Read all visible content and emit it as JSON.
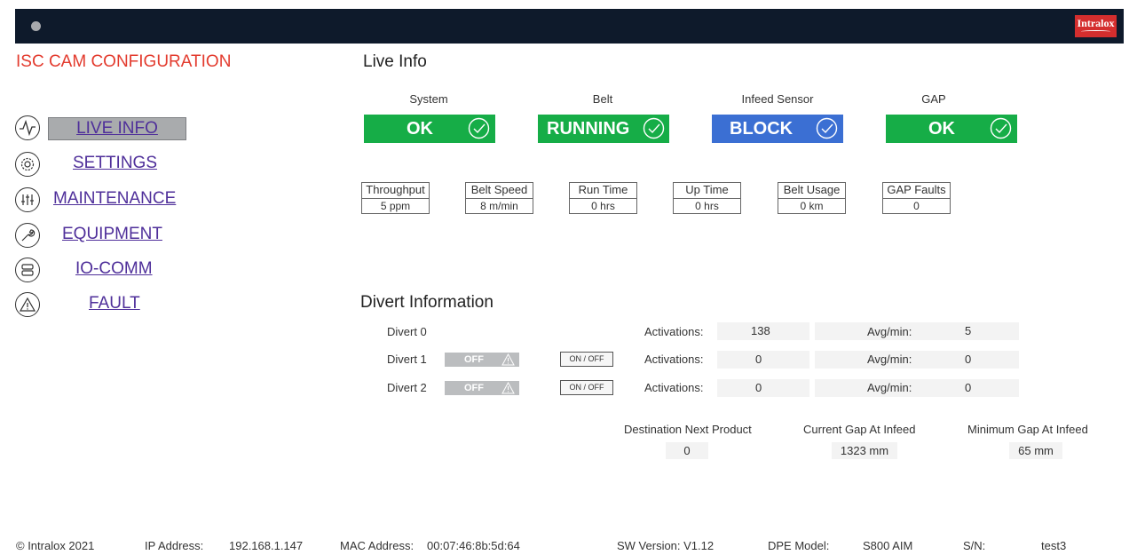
{
  "header": {
    "logo_text": "Intralox"
  },
  "app_title": "ISC CAM CONFIGURATION",
  "nav": [
    {
      "label": "LIVE INFO",
      "icon": "pulse-icon",
      "active": true
    },
    {
      "label": "SETTINGS",
      "icon": "gear-icon"
    },
    {
      "label": "MAINTENANCE",
      "icon": "sliders-icon"
    },
    {
      "label": "EQUIPMENT",
      "icon": "wrench-icon"
    },
    {
      "label": "IO-COMM",
      "icon": "server-icon"
    },
    {
      "label": "FAULT",
      "icon": "warning-icon"
    }
  ],
  "live_info": {
    "title": "Live Info",
    "statuses": [
      {
        "label": "System",
        "value": "OK",
        "color": "#16ad47"
      },
      {
        "label": "Belt",
        "value": "RUNNING",
        "color": "#16ad47"
      },
      {
        "label": "Infeed Sensor",
        "value": "BLOCK",
        "color": "#3b6fd3"
      },
      {
        "label": "GAP",
        "value": "OK",
        "color": "#16ad47"
      }
    ],
    "metrics": [
      {
        "label": "Throughput",
        "value": "5 ppm"
      },
      {
        "label": "Belt Speed",
        "value": "8 m/min"
      },
      {
        "label": "Run Time",
        "value": "0 hrs"
      },
      {
        "label": "Up Time",
        "value": "0 hrs"
      },
      {
        "label": "Belt Usage",
        "value": "0 km"
      },
      {
        "label": "GAP Faults",
        "value": "0"
      }
    ]
  },
  "divert": {
    "title": "Divert Information",
    "activations_label": "Activations:",
    "avg_label": "Avg/min:",
    "toggle_label": "OFF",
    "onoff_label": "ON / OFF",
    "rows": [
      {
        "name": "Divert 0",
        "activations": "138",
        "avg": "5"
      },
      {
        "name": "Divert 1",
        "activations": "0",
        "avg": "0"
      },
      {
        "name": "Divert 2",
        "activations": "0",
        "avg": "0"
      }
    ]
  },
  "gap_info": {
    "destination_label": "Destination Next Product",
    "destination_value": "0",
    "current_gap_label": "Current Gap At Infeed",
    "current_gap_value": "1323 mm",
    "min_gap_label": "Minimum Gap At Infeed",
    "min_gap_value": "65 mm"
  },
  "footer": {
    "copyright": "© Intralox 2021",
    "ip_label": "IP Address:",
    "ip_value": "192.168.1.147",
    "mac_label": "MAC Address:",
    "mac_value": "00:07:46:8b:5d:64",
    "sw_version": "SW Version: V1.12",
    "dpe_label": "DPE Model:",
    "dpe_value": "S800 AIM",
    "sn_label": "S/N:",
    "sn_value": "test3"
  }
}
